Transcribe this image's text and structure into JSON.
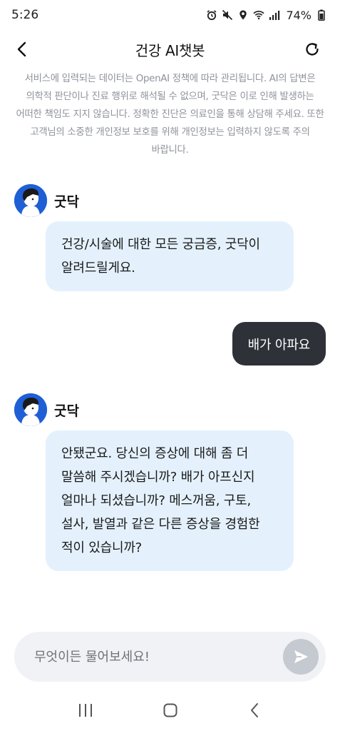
{
  "status_bar": {
    "time": "5:26",
    "battery": "74%",
    "icons": [
      "alarm-icon",
      "mute-icon",
      "location-icon",
      "wifi-icon",
      "signal-icon",
      "battery-icon"
    ]
  },
  "header": {
    "title": "건강 AI챗봇",
    "back_icon": "back-arrow-icon",
    "refresh_icon": "refresh-icon"
  },
  "disclaimer": "서비스에 입력되는 데이터는 OpenAI 정책에 따라 관리됩니다. AI의 답변은 의학적 판단이나 진료 행위로 해석될 수 없으며, 굿닥은 이로 인해 발생하는 어떠한 책임도 지지 않습니다. 정확한 진단은 의료인을 통해 상담해 주세요. 또한 고객님의 소중한 개인정보 보호를 위해 개인정보는 입력하지 않도록 주의 바랍니다.",
  "messages": [
    {
      "sender": "bot",
      "name": "굿닥",
      "text": "건강/시술에 대한 모든 궁금증, 굿닥이 알려드릴게요."
    },
    {
      "sender": "user",
      "text": "배가 아파요"
    },
    {
      "sender": "bot",
      "name": "굿닥",
      "text": "안됐군요. 당신의 증상에 대해 좀 더 말씀해 주시겠습니까? 배가 아프신지 얼마나 되셨습니까? 메스꺼움, 구토, 설사, 발열과 같은 다른 증상을 경험한 적이 있습니까?"
    }
  ],
  "input": {
    "placeholder": "무엇이든 물어보세요!",
    "value": "",
    "send_icon": "send-icon"
  },
  "nav_bar": {
    "icons": [
      "recent-apps-icon",
      "home-icon",
      "back-icon"
    ]
  },
  "colors": {
    "bot_bubble": "#e4f1fd",
    "user_bubble": "#2e3138",
    "avatar_bg": "#1f5fd6",
    "disclaimer_text": "#8e9299",
    "input_bg": "#f1f2f5",
    "send_button": "#c5cad1"
  }
}
